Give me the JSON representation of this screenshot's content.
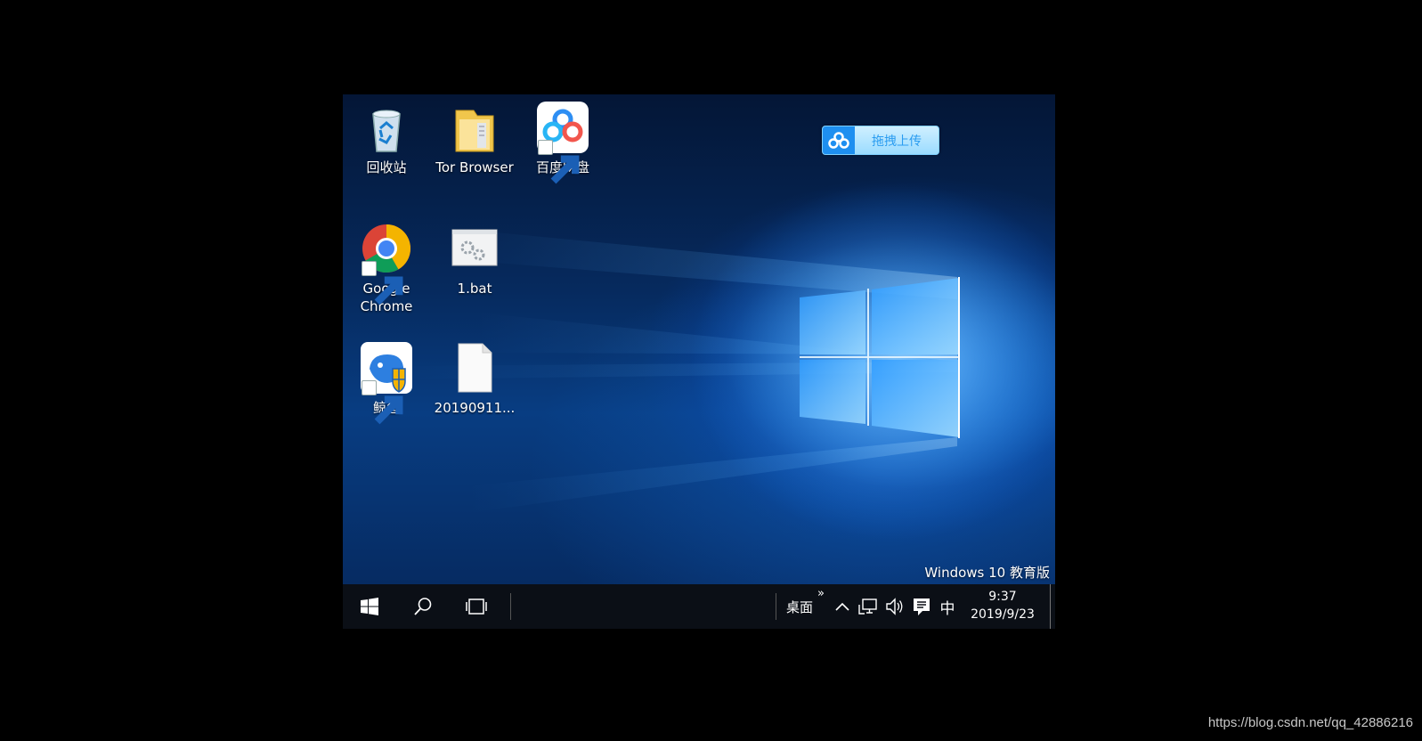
{
  "desktop_icons": [
    {
      "name": "回收站",
      "icon": "recycle-bin-icon"
    },
    {
      "name": "Tor Browser",
      "icon": "folder-icon"
    },
    {
      "name": "百度网盘",
      "icon": "baidu-netdisk-icon"
    },
    {
      "name_line1": "Google",
      "name_line2": "Chrome",
      "icon": "chrome-icon"
    },
    {
      "name": "1.bat",
      "icon": "batch-file-icon"
    },
    {
      "name": "鲸鱼",
      "icon": "whale-app-icon"
    },
    {
      "name": "20190911...",
      "icon": "blank-file-icon"
    }
  ],
  "baidu_upload": {
    "label": "拖拽上传",
    "icon": "baidu-cloud-icon"
  },
  "edition": "Windows 10 教育版",
  "taskbar": {
    "start_icon": "windows-logo-icon",
    "search_icon": "search-icon",
    "taskview_icon": "task-view-icon",
    "desktop_toolbar_label": "桌面",
    "overflow_glyph": "»",
    "tray_expand_icon": "chevron-up-icon",
    "network_icon": "network-icon",
    "volume_icon": "speaker-icon",
    "notification_icon": "action-center-icon",
    "ime_label": "中",
    "time": "9:37",
    "date": "2019/9/23"
  },
  "page_watermark": "https://blog.csdn.net/qq_42886216",
  "colors": {
    "taskbar_bg": "#0b0f16",
    "wallpaper_blue": "#1a8cff",
    "baidu_blue": "#1e8ff0"
  }
}
